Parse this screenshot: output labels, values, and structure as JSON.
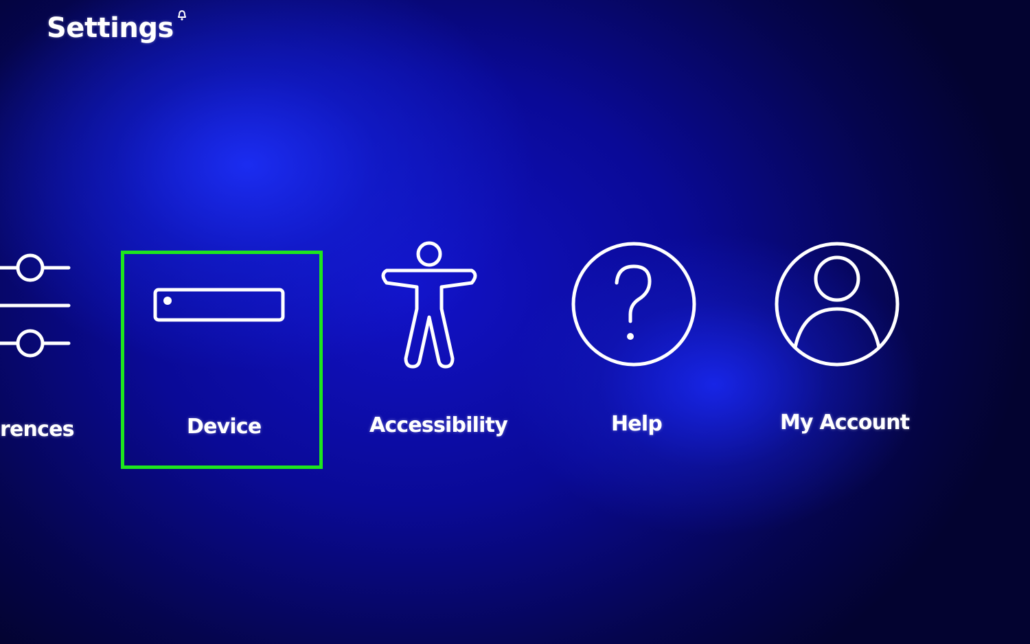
{
  "header": {
    "title": "Settings",
    "notification_icon": "bell-icon"
  },
  "menu": {
    "items": [
      {
        "label": "rences",
        "icon": "sliders-icon"
      },
      {
        "label": "Device",
        "icon": "device-icon",
        "focused": true
      },
      {
        "label": "Accessibility",
        "icon": "accessibility-icon"
      },
      {
        "label": "Help",
        "icon": "help-icon"
      },
      {
        "label": "My Account",
        "icon": "account-icon"
      }
    ]
  },
  "colors": {
    "focus_outline": "#1ee61e",
    "background_deep": "#05054e",
    "background_glow": "#1212c8",
    "text": "#ffffff"
  }
}
